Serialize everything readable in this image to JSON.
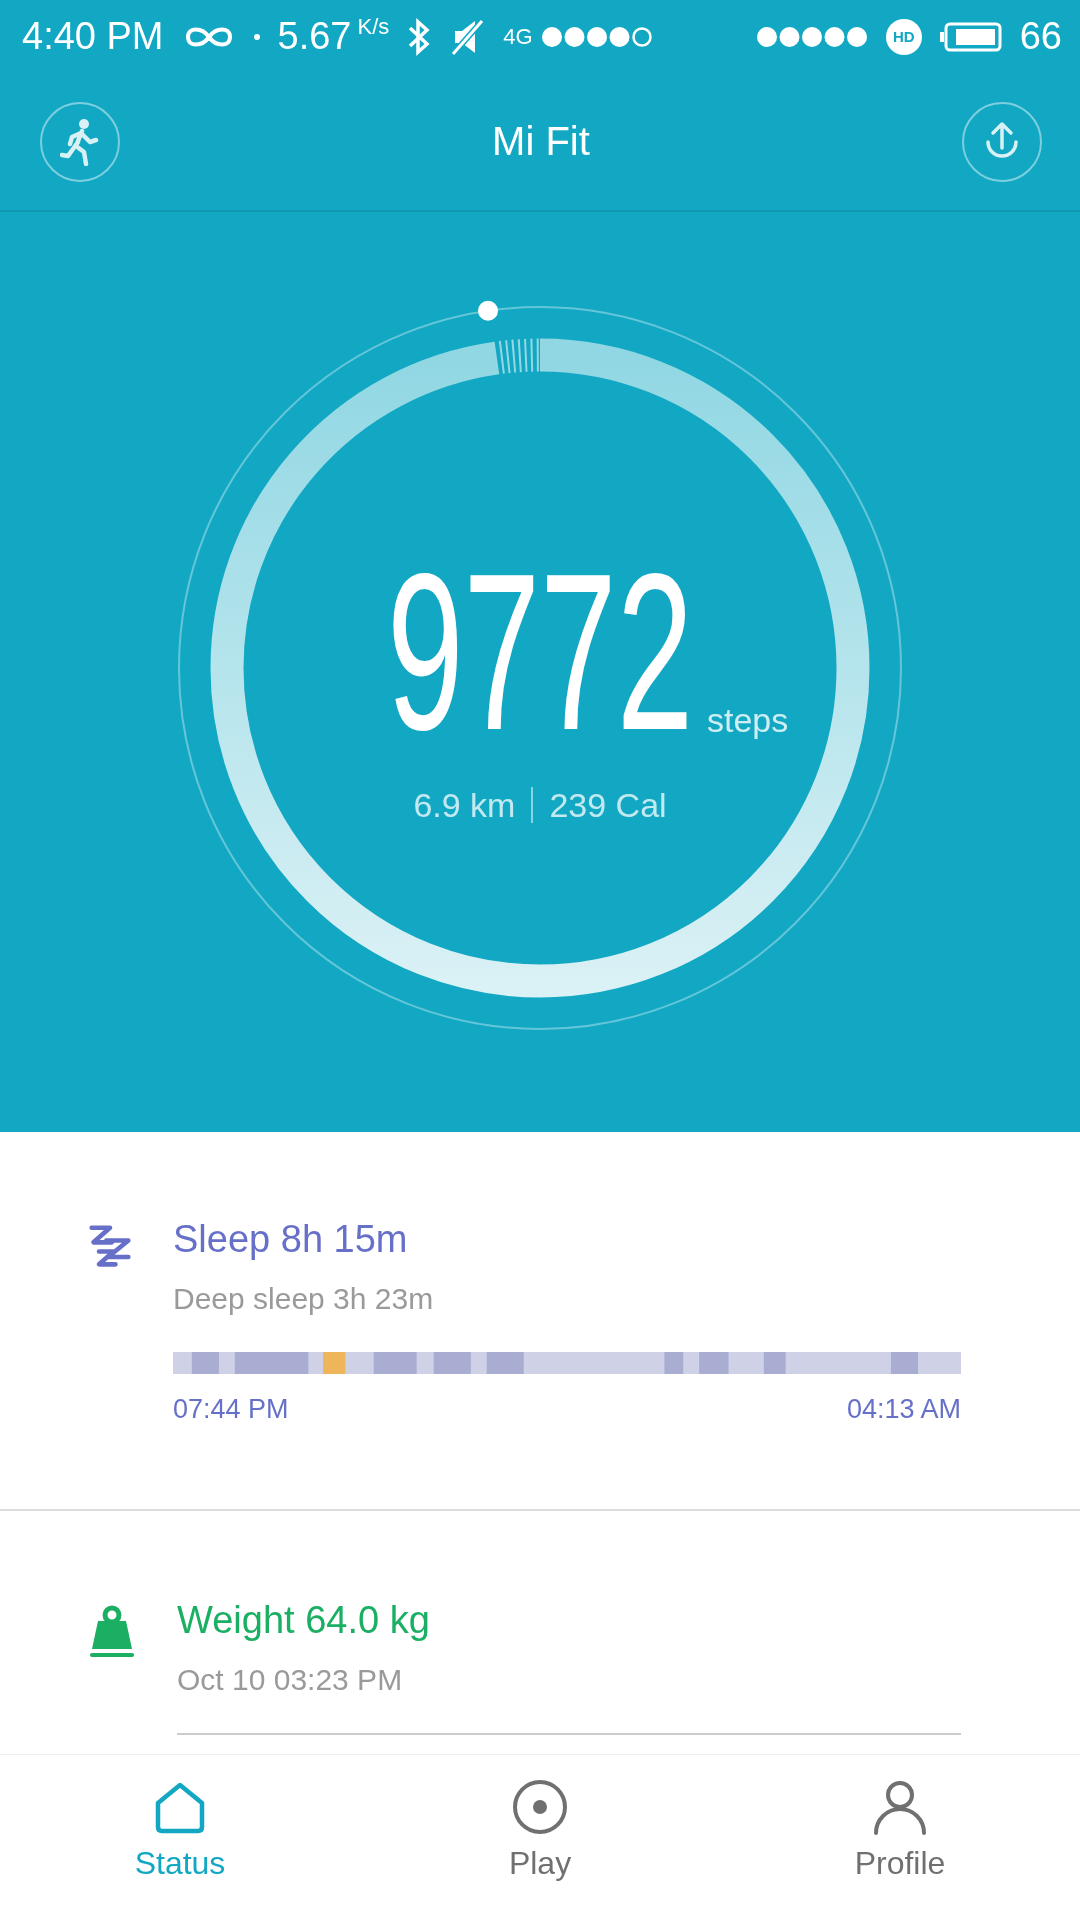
{
  "status_bar": {
    "time": "4:40 PM",
    "speed": "5.67",
    "speed_unit": "K/s",
    "network": "4G",
    "hd": "HD",
    "battery": "66"
  },
  "header": {
    "title": "Mi Fit"
  },
  "steps": {
    "count": "9772",
    "unit": "steps",
    "distance": "6.9 km",
    "calories": "239 Cal",
    "level": 0.977
  },
  "cards": [
    {
      "kind": "sleep",
      "title": "Sleep 8h 15m",
      "subtitle": "Deep sleep 3h 23m",
      "start": "07:44 PM",
      "end": "04:13 AM"
    },
    {
      "kind": "weight",
      "title": "Weight 64.0 kg",
      "subtitle": "Oct 10 03:23 PM"
    }
  ],
  "tabs": [
    {
      "label": "Status",
      "selected": true
    },
    {
      "label": "Play",
      "selected": false
    },
    {
      "label": "Profile",
      "selected": false
    }
  ]
}
